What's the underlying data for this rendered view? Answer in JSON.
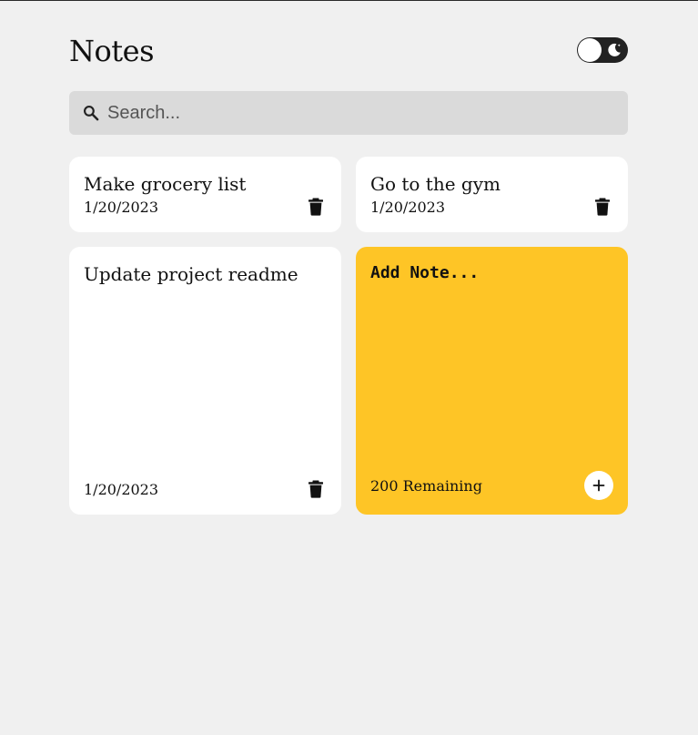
{
  "app": {
    "title": "Notes"
  },
  "theme_toggle": {
    "state": "light",
    "icon": "moon-icon"
  },
  "search": {
    "placeholder": "Search...",
    "value": ""
  },
  "notes": [
    {
      "text": "Make grocery list",
      "date": "1/20/2023"
    },
    {
      "text": "Go to the gym",
      "date": "1/20/2023"
    },
    {
      "text": "Update project readme",
      "date": "1/20/2023"
    }
  ],
  "add_note": {
    "placeholder": "Add Note...",
    "value": "",
    "remaining_label": "200 Remaining",
    "button_icon": "plus-icon"
  },
  "colors": {
    "background": "#f0f0f0",
    "card": "#ffffff",
    "accent": "#fec526",
    "search_bg": "#dadada",
    "text": "#111111"
  }
}
